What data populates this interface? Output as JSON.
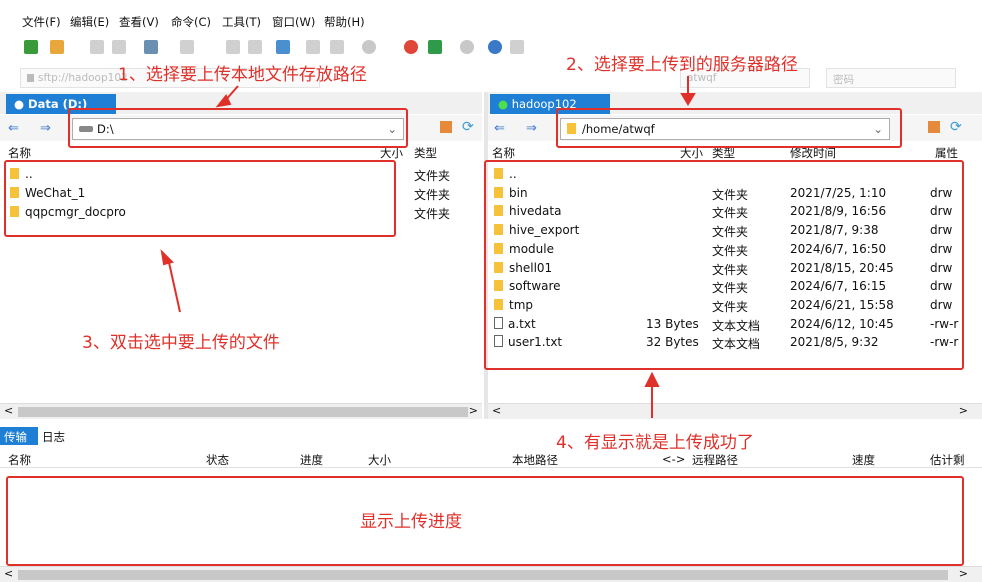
{
  "menu": [
    "文件(F)",
    "编辑(E)",
    "查看(V)",
    "命令(C)",
    "工具(T)",
    "窗口(W)",
    "帮助(H)"
  ],
  "address": {
    "host": "sftp://hadoop102",
    "user": "atwqf",
    "password_placeholder": "密码"
  },
  "left_pane": {
    "tab": "Data (D:)",
    "path": "D:\\",
    "headers": {
      "name": "名称",
      "size": "大小",
      "type": "类型"
    },
    "rows": [
      {
        "name": "..",
        "type": "文件夹"
      },
      {
        "name": "WeChat_1",
        "type": "文件夹"
      },
      {
        "name": "qqpcmgr_docpro",
        "type": "文件夹"
      }
    ]
  },
  "right_pane": {
    "tab": "hadoop102",
    "path": "/home/atwqf",
    "headers": {
      "name": "名称",
      "size": "大小",
      "type": "类型",
      "mtime": "修改时间",
      "attr": "属性"
    },
    "rows": [
      {
        "name": "..",
        "size": "",
        "type": "",
        "mtime": "",
        "attr": "",
        "icon": "folder"
      },
      {
        "name": "bin",
        "size": "",
        "type": "文件夹",
        "mtime": "2021/7/25, 1:10",
        "attr": "drw",
        "icon": "folder"
      },
      {
        "name": "hivedata",
        "size": "",
        "type": "文件夹",
        "mtime": "2021/8/9, 16:56",
        "attr": "drw",
        "icon": "folder"
      },
      {
        "name": "hive_export",
        "size": "",
        "type": "文件夹",
        "mtime": "2021/8/7, 9:38",
        "attr": "drw",
        "icon": "folder"
      },
      {
        "name": "module",
        "size": "",
        "type": "文件夹",
        "mtime": "2024/6/7, 16:50",
        "attr": "drw",
        "icon": "folder"
      },
      {
        "name": "shell01",
        "size": "",
        "type": "文件夹",
        "mtime": "2021/8/15, 20:45",
        "attr": "drw",
        "icon": "folder"
      },
      {
        "name": "software",
        "size": "",
        "type": "文件夹",
        "mtime": "2024/6/7, 16:15",
        "attr": "drw",
        "icon": "folder"
      },
      {
        "name": "tmp",
        "size": "",
        "type": "文件夹",
        "mtime": "2024/6/21, 15:58",
        "attr": "drw",
        "icon": "folder"
      },
      {
        "name": "a.txt",
        "size": "13 Bytes",
        "type": "文本文档",
        "mtime": "2024/6/12, 10:45",
        "attr": "-rw-r",
        "icon": "file"
      },
      {
        "name": "user1.txt",
        "size": "32 Bytes",
        "type": "文本文档",
        "mtime": "2021/8/5, 9:32",
        "attr": "-rw-r",
        "icon": "file"
      }
    ]
  },
  "transfer": {
    "tabs": [
      "传输",
      "日志"
    ],
    "headers": [
      "名称",
      "状态",
      "进度",
      "大小",
      "本地路径",
      "<->",
      "远程路径",
      "速度",
      "估计剩"
    ]
  },
  "annotations": {
    "step1": "1、选择要上传本地文件存放路径",
    "step2": "2、选择要上传到的服务器路径",
    "step3": "3、双击选中要上传的文件",
    "step4": "4、有显示就是上传成功了",
    "progress": "显示上传进度"
  },
  "colors": {
    "accent": "#1e7fd4",
    "annotation": "#e0302a",
    "folder": "#f5c23a"
  }
}
